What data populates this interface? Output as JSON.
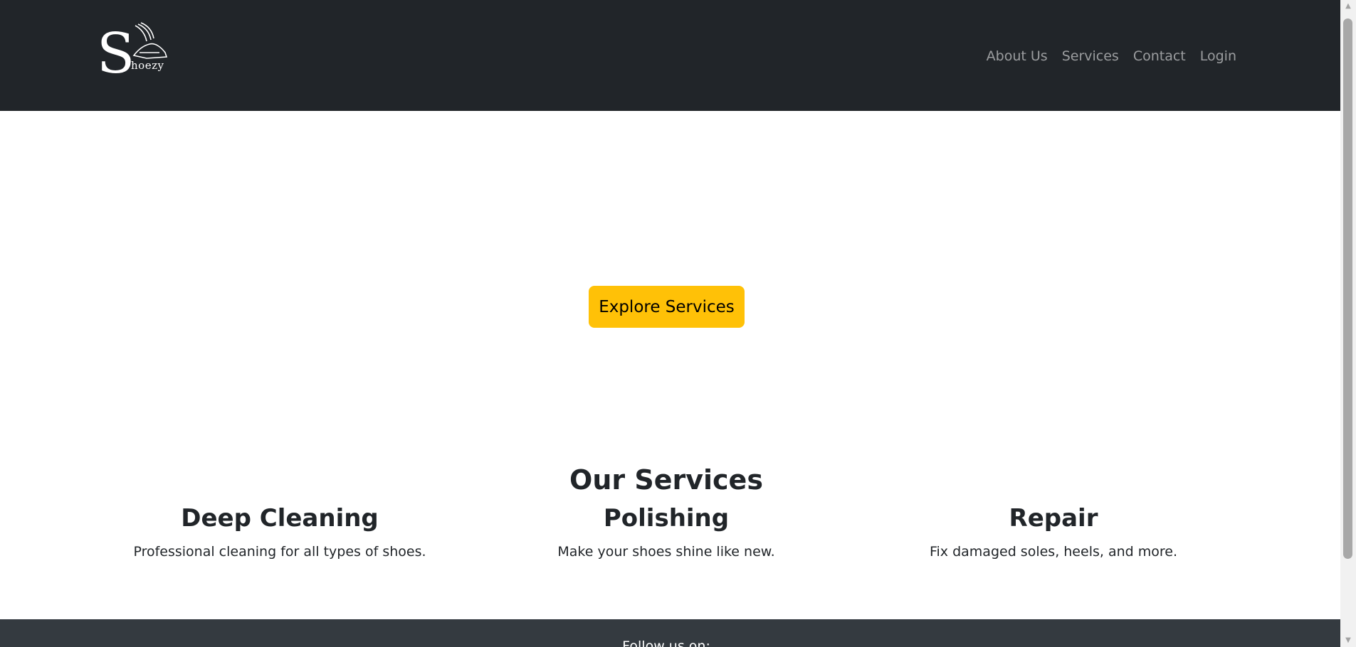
{
  "header": {
    "logo": {
      "letter": "S",
      "wordmark": "hoezy",
      "icon": "winged-shoe-icon"
    },
    "nav": [
      {
        "label": "About Us"
      },
      {
        "label": "Services"
      },
      {
        "label": "Contact"
      },
      {
        "label": "Login"
      }
    ]
  },
  "hero": {
    "cta_label": "Explore Services"
  },
  "services": {
    "title": "Our Services",
    "items": [
      {
        "title": "Deep Cleaning",
        "description": "Professional cleaning for all types of shoes."
      },
      {
        "title": "Polishing",
        "description": "Make your shoes shine like new."
      },
      {
        "title": "Repair",
        "description": "Fix damaged soles, heels, and more."
      }
    ]
  },
  "footer": {
    "follow_text": "Follow us on:"
  },
  "colors": {
    "header_bg": "#212529",
    "footer_bg": "#343a40",
    "accent": "#ffc107",
    "nav_text": "#8c8f92",
    "body_text": "#212529"
  }
}
